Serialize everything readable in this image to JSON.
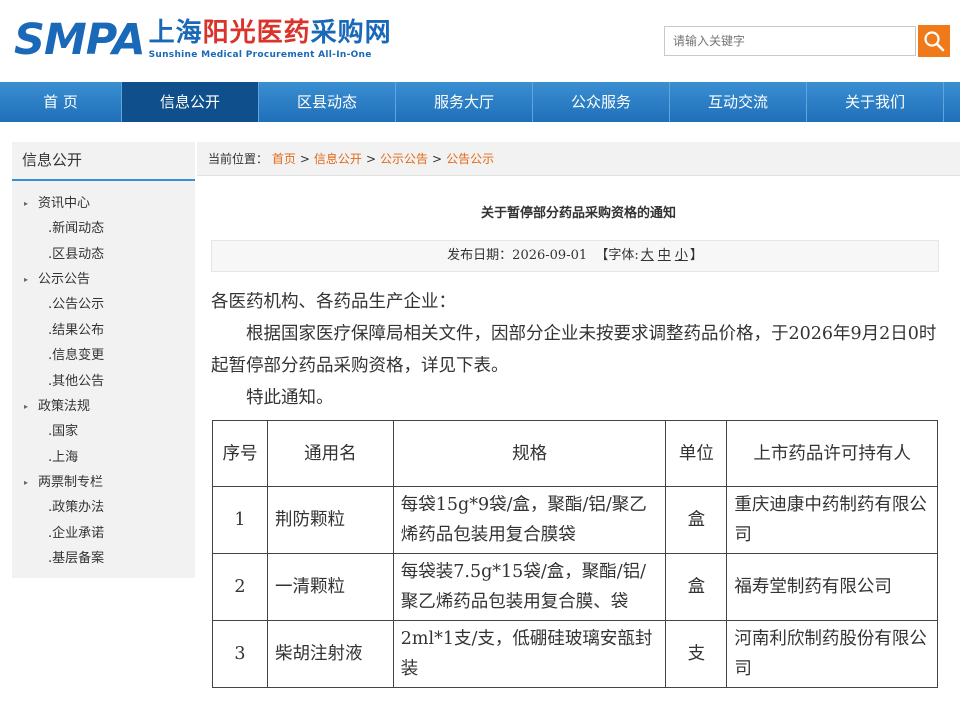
{
  "header": {
    "logo_abbr": "SMPA",
    "logo_cn_1": "上海",
    "logo_cn_2": "阳光医药",
    "logo_cn_3": "采购网",
    "logo_en": "Sunshine Medical Procurement All-In-One",
    "search_placeholder": "请输入关键字"
  },
  "nav": {
    "items": [
      "首 页",
      "信息公开",
      "区县动态",
      "服务大厅",
      "公众服务",
      "互动交流",
      "关于我们"
    ],
    "active_index": 1
  },
  "sidebar": {
    "title": "信息公开",
    "groups": [
      {
        "label": "资讯中心",
        "items": [
          "新闻动态",
          "区县动态"
        ]
      },
      {
        "label": "公示公告",
        "items": [
          "公告公示",
          "结果公布",
          "信息变更",
          "其他公告"
        ]
      },
      {
        "label": "政策法规",
        "items": [
          "国家",
          "上海"
        ]
      },
      {
        "label": "两票制专栏",
        "items": [
          "政策办法",
          "企业承诺",
          "基层备案"
        ]
      }
    ]
  },
  "breadcrumb": {
    "label": "当前位置：",
    "items": [
      "首页",
      "信息公开",
      "公示公告",
      "公告公示"
    ]
  },
  "article": {
    "title": "关于暂停部分药品采购资格的通知",
    "date_prefix": "发布日期：",
    "date": "2026-09-01",
    "font_size_prefix": "【字体:",
    "font_large": "大",
    "font_medium": "中",
    "font_small": "小",
    "font_size_suffix": "】",
    "salutation": "各医药机构、各药品生产企业：",
    "body": "根据国家医疗保障局相关文件，因部分企业未按要求调整药品价格，于2026年9月2日0时起暂停部分药品采购资格，详见下表。",
    "closing": "特此通知。"
  },
  "table": {
    "headers": [
      "序号",
      "通用名",
      "规格",
      "单位",
      "上市药品许可持有人"
    ],
    "rows": [
      [
        "1",
        "荆防颗粒",
        "每袋15g*9袋/盒，聚酯/铝/聚乙烯药品包装用复合膜袋",
        "盒",
        "重庆迪康中药制药有限公司"
      ],
      [
        "2",
        "一清颗粒",
        "每袋装7.5g*15袋/盒，聚酯/铝/聚乙烯药品包装用复合膜、袋",
        "盒",
        "福寿堂制药有限公司"
      ],
      [
        "3",
        "柴胡注射液",
        "2ml*1支/支，低硼硅玻璃安瓿封装",
        "支",
        "河南利欣制药股份有限公司"
      ]
    ]
  },
  "colors": {
    "brand_blue": "#1a69b8",
    "accent_red": "#d9332a",
    "link_orange": "#e06a1a",
    "search_button": "#f07a1a"
  }
}
